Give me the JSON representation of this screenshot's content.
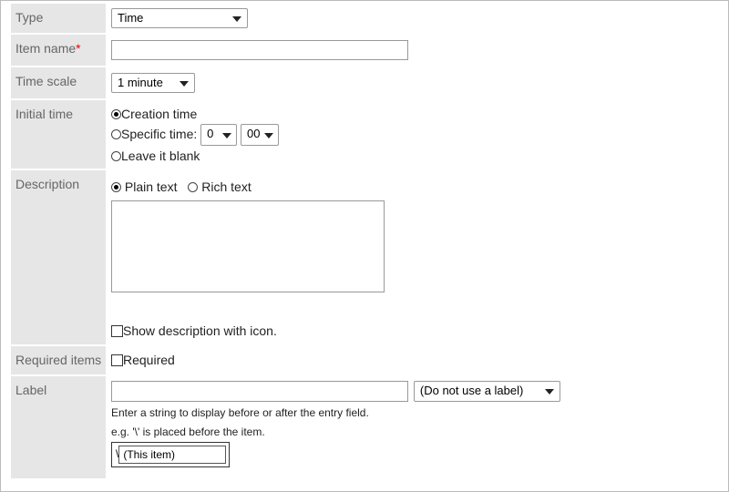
{
  "fields": {
    "type": {
      "label": "Type",
      "value": "Time"
    },
    "item_name": {
      "label": "Item name",
      "required_mark": "*",
      "value": ""
    },
    "time_scale": {
      "label": "Time scale",
      "value": "1 minute"
    },
    "initial_time": {
      "label": "Initial time",
      "options": [
        "Creation time",
        "Specific time:",
        "Leave it blank"
      ],
      "selected": 0,
      "hour": "0",
      "minute": "00"
    },
    "description": {
      "label": "Description",
      "format_options": [
        "Plain text",
        "Rich text"
      ],
      "selected": 0,
      "text": "",
      "show_icon_label": "Show description with icon."
    },
    "required_items": {
      "label": "Required items",
      "checkbox_label": "Required"
    },
    "label": {
      "label": "Label",
      "value": "",
      "position_select": "(Do not use a label)",
      "hint": "Enter a string to display before or after the entry field.",
      "example": "e.g.  '\\' is placed before the item.",
      "example_prefix": "\\",
      "example_item": "(This item)"
    }
  }
}
